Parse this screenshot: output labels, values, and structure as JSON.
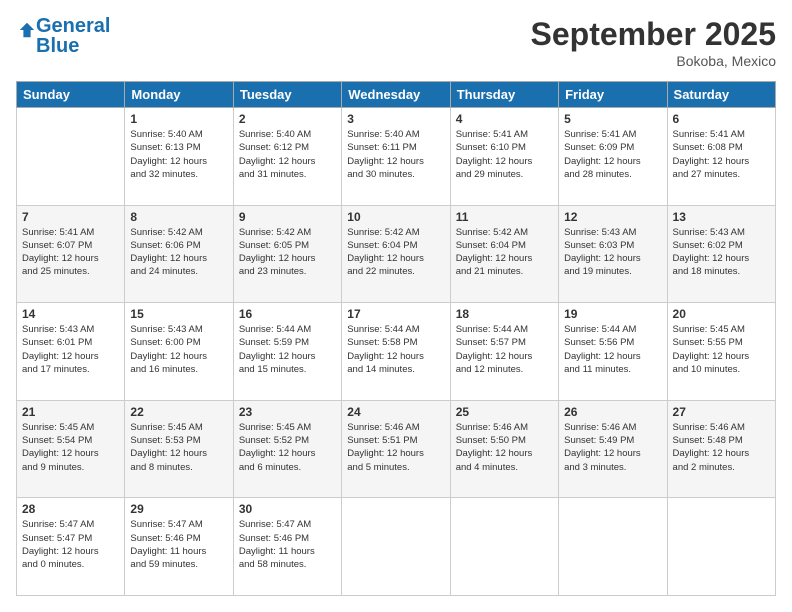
{
  "header": {
    "logo_line1": "General",
    "logo_line2": "Blue",
    "title": "September 2025",
    "location": "Bokoba, Mexico"
  },
  "columns": [
    "Sunday",
    "Monday",
    "Tuesday",
    "Wednesday",
    "Thursday",
    "Friday",
    "Saturday"
  ],
  "weeks": [
    [
      {
        "day": "",
        "info": ""
      },
      {
        "day": "1",
        "info": "Sunrise: 5:40 AM\nSunset: 6:13 PM\nDaylight: 12 hours\nand 32 minutes."
      },
      {
        "day": "2",
        "info": "Sunrise: 5:40 AM\nSunset: 6:12 PM\nDaylight: 12 hours\nand 31 minutes."
      },
      {
        "day": "3",
        "info": "Sunrise: 5:40 AM\nSunset: 6:11 PM\nDaylight: 12 hours\nand 30 minutes."
      },
      {
        "day": "4",
        "info": "Sunrise: 5:41 AM\nSunset: 6:10 PM\nDaylight: 12 hours\nand 29 minutes."
      },
      {
        "day": "5",
        "info": "Sunrise: 5:41 AM\nSunset: 6:09 PM\nDaylight: 12 hours\nand 28 minutes."
      },
      {
        "day": "6",
        "info": "Sunrise: 5:41 AM\nSunset: 6:08 PM\nDaylight: 12 hours\nand 27 minutes."
      }
    ],
    [
      {
        "day": "7",
        "info": "Sunrise: 5:41 AM\nSunset: 6:07 PM\nDaylight: 12 hours\nand 25 minutes."
      },
      {
        "day": "8",
        "info": "Sunrise: 5:42 AM\nSunset: 6:06 PM\nDaylight: 12 hours\nand 24 minutes."
      },
      {
        "day": "9",
        "info": "Sunrise: 5:42 AM\nSunset: 6:05 PM\nDaylight: 12 hours\nand 23 minutes."
      },
      {
        "day": "10",
        "info": "Sunrise: 5:42 AM\nSunset: 6:04 PM\nDaylight: 12 hours\nand 22 minutes."
      },
      {
        "day": "11",
        "info": "Sunrise: 5:42 AM\nSunset: 6:04 PM\nDaylight: 12 hours\nand 21 minutes."
      },
      {
        "day": "12",
        "info": "Sunrise: 5:43 AM\nSunset: 6:03 PM\nDaylight: 12 hours\nand 19 minutes."
      },
      {
        "day": "13",
        "info": "Sunrise: 5:43 AM\nSunset: 6:02 PM\nDaylight: 12 hours\nand 18 minutes."
      }
    ],
    [
      {
        "day": "14",
        "info": "Sunrise: 5:43 AM\nSunset: 6:01 PM\nDaylight: 12 hours\nand 17 minutes."
      },
      {
        "day": "15",
        "info": "Sunrise: 5:43 AM\nSunset: 6:00 PM\nDaylight: 12 hours\nand 16 minutes."
      },
      {
        "day": "16",
        "info": "Sunrise: 5:44 AM\nSunset: 5:59 PM\nDaylight: 12 hours\nand 15 minutes."
      },
      {
        "day": "17",
        "info": "Sunrise: 5:44 AM\nSunset: 5:58 PM\nDaylight: 12 hours\nand 14 minutes."
      },
      {
        "day": "18",
        "info": "Sunrise: 5:44 AM\nSunset: 5:57 PM\nDaylight: 12 hours\nand 12 minutes."
      },
      {
        "day": "19",
        "info": "Sunrise: 5:44 AM\nSunset: 5:56 PM\nDaylight: 12 hours\nand 11 minutes."
      },
      {
        "day": "20",
        "info": "Sunrise: 5:45 AM\nSunset: 5:55 PM\nDaylight: 12 hours\nand 10 minutes."
      }
    ],
    [
      {
        "day": "21",
        "info": "Sunrise: 5:45 AM\nSunset: 5:54 PM\nDaylight: 12 hours\nand 9 minutes."
      },
      {
        "day": "22",
        "info": "Sunrise: 5:45 AM\nSunset: 5:53 PM\nDaylight: 12 hours\nand 8 minutes."
      },
      {
        "day": "23",
        "info": "Sunrise: 5:45 AM\nSunset: 5:52 PM\nDaylight: 12 hours\nand 6 minutes."
      },
      {
        "day": "24",
        "info": "Sunrise: 5:46 AM\nSunset: 5:51 PM\nDaylight: 12 hours\nand 5 minutes."
      },
      {
        "day": "25",
        "info": "Sunrise: 5:46 AM\nSunset: 5:50 PM\nDaylight: 12 hours\nand 4 minutes."
      },
      {
        "day": "26",
        "info": "Sunrise: 5:46 AM\nSunset: 5:49 PM\nDaylight: 12 hours\nand 3 minutes."
      },
      {
        "day": "27",
        "info": "Sunrise: 5:46 AM\nSunset: 5:48 PM\nDaylight: 12 hours\nand 2 minutes."
      }
    ],
    [
      {
        "day": "28",
        "info": "Sunrise: 5:47 AM\nSunset: 5:47 PM\nDaylight: 12 hours\nand 0 minutes."
      },
      {
        "day": "29",
        "info": "Sunrise: 5:47 AM\nSunset: 5:46 PM\nDaylight: 11 hours\nand 59 minutes."
      },
      {
        "day": "30",
        "info": "Sunrise: 5:47 AM\nSunset: 5:46 PM\nDaylight: 11 hours\nand 58 minutes."
      },
      {
        "day": "",
        "info": ""
      },
      {
        "day": "",
        "info": ""
      },
      {
        "day": "",
        "info": ""
      },
      {
        "day": "",
        "info": ""
      }
    ]
  ]
}
